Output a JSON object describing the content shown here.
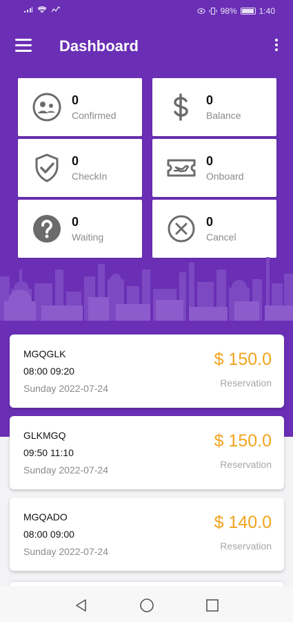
{
  "status_bar": {
    "battery": "98%",
    "time": "1:40"
  },
  "app_bar": {
    "title": "Dashboard"
  },
  "stats": [
    {
      "icon": "person-smile-icon",
      "count": "0",
      "label": "Confirmed"
    },
    {
      "icon": "dollar-icon",
      "count": "0",
      "label": "Balance"
    },
    {
      "icon": "shield-check-icon",
      "count": "0",
      "label": "CheckIn"
    },
    {
      "icon": "boarding-ticket-icon",
      "count": "0",
      "label": "Onboard"
    },
    {
      "icon": "question-circle-icon",
      "count": "0",
      "label": "Waiting"
    },
    {
      "icon": "cancel-circle-icon",
      "count": "0",
      "label": "Cancel"
    }
  ],
  "reservations": [
    {
      "route": "MGQGLK",
      "time": "08:00 09:20",
      "date": "Sunday 2022-07-24",
      "price": "$ 150.0",
      "type": "Reservation"
    },
    {
      "route": "GLKMGQ",
      "time": "09:50 11:10",
      "date": "Sunday 2022-07-24",
      "price": "$ 150.0",
      "type": "Reservation"
    },
    {
      "route": "MGQADO",
      "time": "08:00 09:00",
      "date": "Sunday 2022-07-24",
      "price": "$ 140.0",
      "type": "Reservation"
    }
  ],
  "colors": {
    "primary": "#6a2fb5",
    "price": "#f1a31d",
    "icon": "#6b6b6b"
  }
}
